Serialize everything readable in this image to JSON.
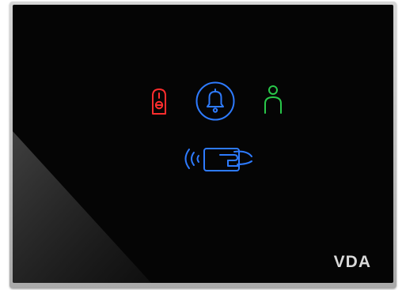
{
  "device": {
    "brand_logo": "VDA"
  },
  "indicators": {
    "do_not_disturb": {
      "icon": "door-hanger-icon",
      "color": "#ff2d2d"
    },
    "doorbell": {
      "icon": "bell-icon",
      "color": "#2e7bff"
    },
    "guest_present": {
      "icon": "person-icon",
      "color": "#29c84a"
    },
    "card_reader": {
      "icon": "rfid-card-icon",
      "color": "#2e7bff"
    }
  }
}
